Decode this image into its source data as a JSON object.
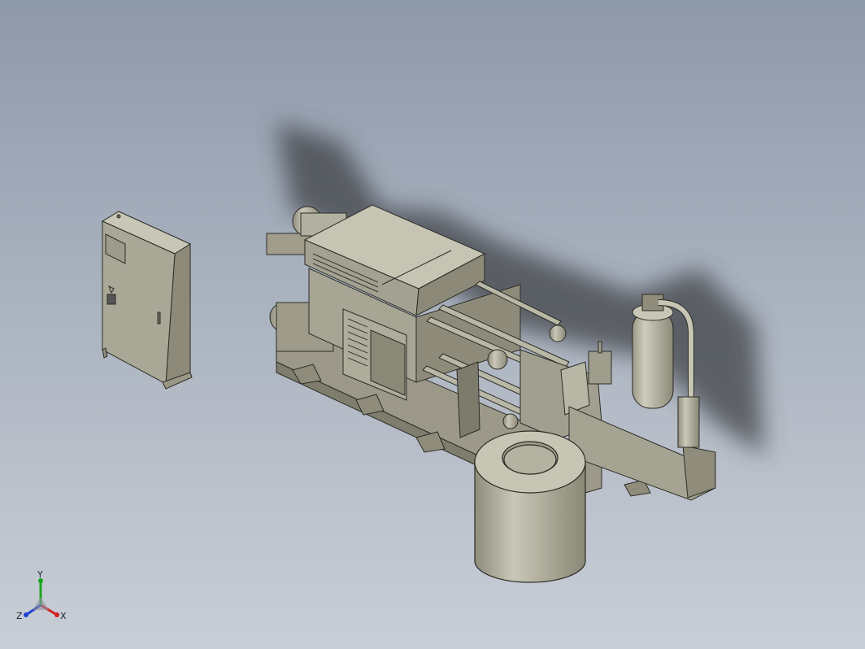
{
  "view": {
    "background_top": "#8e99aa",
    "background_bottom": "#c9ced6",
    "part_color": "#a9a796"
  },
  "triad": {
    "x_label": "X",
    "y_label": "Y",
    "z_label": "Z",
    "x_color": "#d42020",
    "y_color": "#1aa51a",
    "z_color": "#2040d0"
  }
}
